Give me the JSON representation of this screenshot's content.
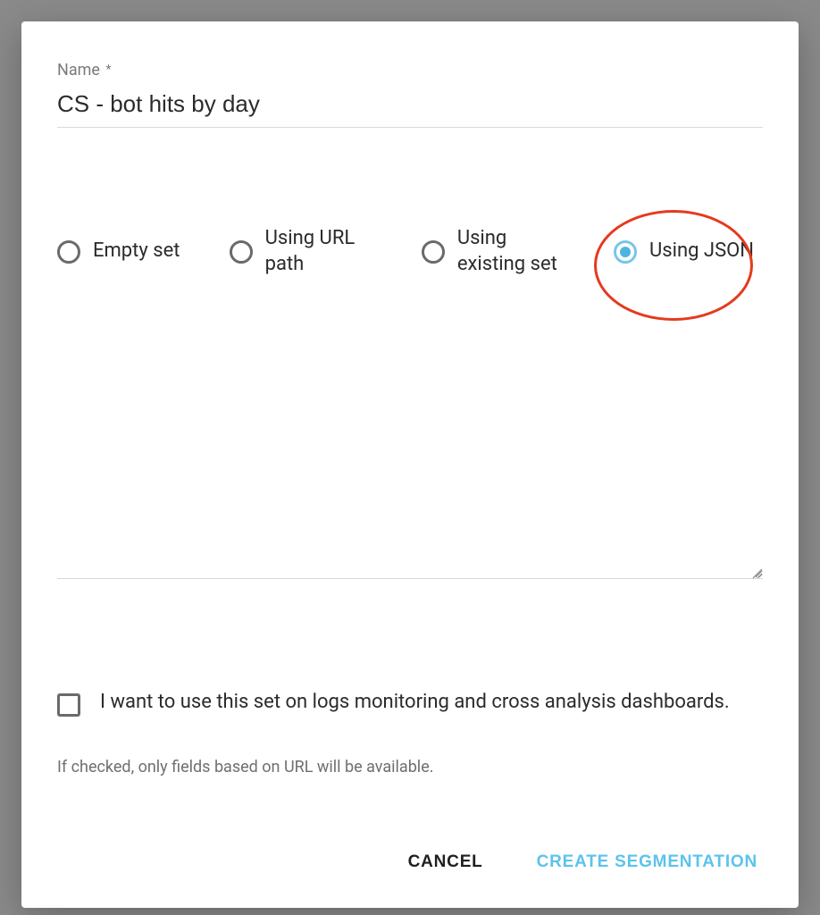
{
  "form": {
    "name_label": "Name",
    "name_required_mark": "*",
    "name_value": "CS - bot hits by day"
  },
  "options": [
    {
      "id": "empty-set",
      "label": "Empty set",
      "selected": false
    },
    {
      "id": "url-path",
      "label": "Using URL path",
      "selected": false
    },
    {
      "id": "existing-set",
      "label": "Using existing set",
      "selected": false
    },
    {
      "id": "using-json",
      "label": "Using JSON",
      "selected": true,
      "highlighted": true
    }
  ],
  "textarea": {
    "value": ""
  },
  "checkbox": {
    "label": "I want to use this set on logs monitoring and cross analysis dashboards.",
    "checked": false,
    "help": "If checked, only fields based on URL will be available."
  },
  "actions": {
    "cancel": "CANCEL",
    "primary": "CREATE SEGMENTATION"
  }
}
